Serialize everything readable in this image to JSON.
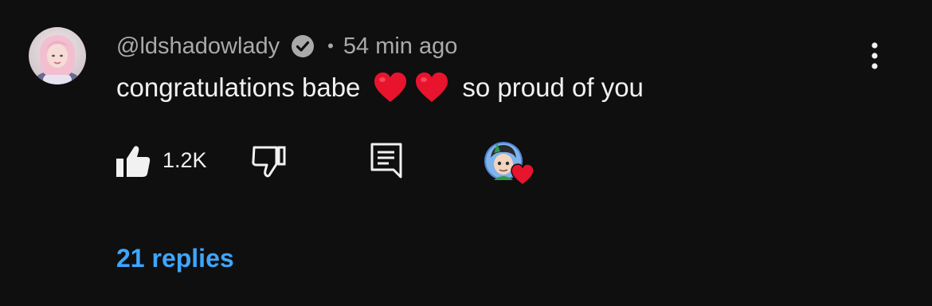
{
  "comment": {
    "author": "@ldshadowlady",
    "separator": "•",
    "time": "54 min ago",
    "text_before": "congratulations babe",
    "text_after": "so proud of you",
    "hearts": [
      "❤️",
      "❤️"
    ],
    "like_count": "1.2K",
    "replies_label": "21 replies"
  },
  "icons": {
    "verified": "verified-check-icon",
    "like": "thumbs-up-icon",
    "dislike": "thumbs-down-icon",
    "reply": "reply-icon",
    "menu": "more-vert-icon",
    "creator_heart": "heart-icon"
  },
  "colors": {
    "background": "#0f0f0f",
    "text": "#f1f1f1",
    "secondary_text": "#aaaaaa",
    "link": "#3ea6ff",
    "heart": "#e8132d"
  }
}
